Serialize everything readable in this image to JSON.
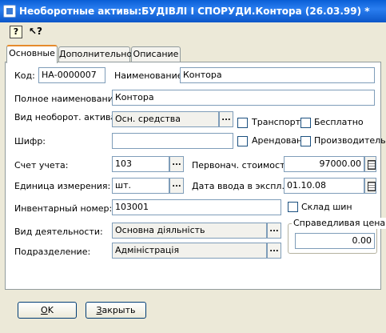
{
  "window": {
    "title": "Необоротные активы:БУДІВЛІ І СПОРУДИ.Контора (26.03.99) *"
  },
  "toolbar": {
    "help_glyph": "?",
    "whatsthis_glyph": "↖?"
  },
  "tabs": [
    {
      "label": "Основные",
      "active": true
    },
    {
      "label": "Дополнительно",
      "active": false
    },
    {
      "label": "Описание",
      "active": false
    }
  ],
  "form": {
    "code": {
      "label": "Код:",
      "value": "НА-0000007"
    },
    "name": {
      "label": "Наименование:",
      "value": "Контора"
    },
    "full_name": {
      "label": "Полное наименование:",
      "value": "Контора"
    },
    "asset_type": {
      "label": "Вид необорот. актива:",
      "value": "Осн. средства"
    },
    "cipher": {
      "label": "Шифр:",
      "value": ""
    },
    "account": {
      "label": "Счет учета:",
      "value": "103"
    },
    "unit": {
      "label": "Единица измерения:",
      "value": "шт."
    },
    "inventory_number": {
      "label": "Инвентарный номер:",
      "value": "103001"
    },
    "activity_type": {
      "label": "Вид деятельности:",
      "value": "Основна діяльність"
    },
    "department": {
      "label": "Подразделение:",
      "value": "Адміністрація"
    },
    "initial_cost": {
      "label": "Первонач. стоимость:",
      "value": "97000.00"
    },
    "commission_date": {
      "label": "Дата ввода в экспл.:",
      "value": "01.10.08"
    },
    "fair_price": {
      "label": "Справедливая цена",
      "value": "0.00"
    },
    "checkboxes": {
      "transport": {
        "label": "Транспорт",
        "checked": false
      },
      "free": {
        "label": "Бесплатно",
        "checked": false
      },
      "leased": {
        "label": "Арендован",
        "checked": false
      },
      "production": {
        "label": "Производитель",
        "checked": false
      },
      "tire_warehouse": {
        "label": "Склад шин",
        "checked": false
      }
    },
    "dots_glyph": "..."
  },
  "buttons": {
    "ok": {
      "underlined": "O",
      "rest": "K"
    },
    "close": {
      "underlined": "З",
      "rest": "акрыть"
    }
  }
}
